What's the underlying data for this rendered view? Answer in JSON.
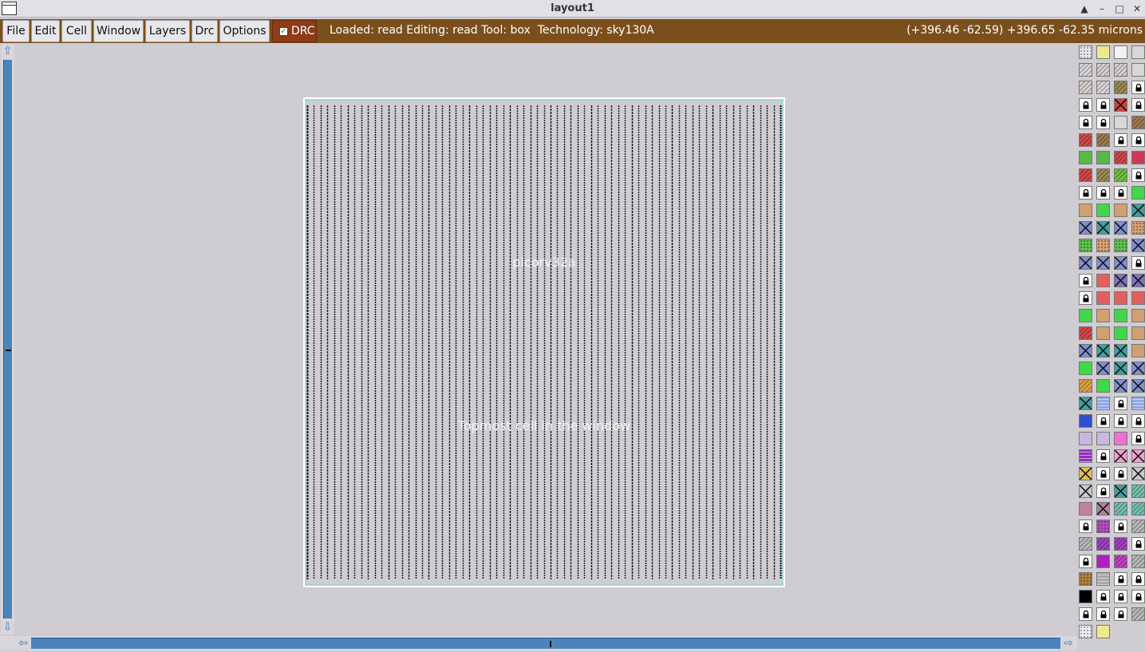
{
  "window": {
    "title": "layout1",
    "buttons": [
      "up-arrow-icon",
      "minimize-icon",
      "maximize-icon",
      "close-icon"
    ]
  },
  "menubar": {
    "items": [
      "File",
      "Edit",
      "Cell",
      "Window",
      "Layers",
      "Drc",
      "Options"
    ],
    "drc_toggle": {
      "label": "DRC",
      "checked": true
    }
  },
  "status": {
    "text": "Loaded: read Editing: read Tool: box  Technology: sky130A",
    "coords": "(+396.46 -62.59) +396.65 -62.35 microns"
  },
  "layout": {
    "cell_name": "picorv32a",
    "caption": "Topmost cell in the window"
  },
  "colors": {
    "menubar_bg": "#7a4f1c",
    "drc_bg": "#8f3a18",
    "scrollbar": "#4a84bb",
    "canvas_bg": "#cfcdd2",
    "cell_outline": "#ffffff",
    "cell_dots": "#5ed8d8"
  },
  "palette": {
    "columns": 4,
    "swatches": [
      "grid",
      "yellow",
      "outline",
      "plain",
      "diag-dark",
      "diag-light",
      "diag-light",
      "plain",
      "diag-light",
      "diag-dark",
      "olive",
      "lock-red",
      "lock",
      "lock",
      "red-x",
      "lock-red",
      "lock",
      "lock",
      "plain",
      "brown",
      "red",
      "brown",
      "lock",
      "lock",
      "green",
      "green",
      "red",
      "crimson",
      "red",
      "olive",
      "green-diag",
      "lock",
      "lock",
      "lock",
      "lock",
      "bright-green",
      "tan",
      "bright-green",
      "tan",
      "teal-x",
      "blue-x",
      "teal-x",
      "blue-x",
      "tan-dots",
      "green-dots",
      "tan-dots",
      "green-dots",
      "blue-x",
      "blue-x",
      "blue-x",
      "blue-x",
      "lock",
      "lock",
      "salmon",
      "purple-x",
      "purple-x",
      "lock",
      "salmon",
      "salmon",
      "salmon",
      "bright-green",
      "tan",
      "bright-green",
      "tan",
      "red",
      "tan",
      "bright-green",
      "tan",
      "blue-x",
      "teal-x",
      "teal-x",
      "tan",
      "bright-green",
      "blue-x",
      "teal-x",
      "blue-x",
      "orange-diag",
      "bright-green",
      "blue-x",
      "blue-x",
      "teal-x",
      "wave-blue",
      "lock",
      "wave-blue",
      "blue-check",
      "lock",
      "lock",
      "lock",
      "lavender",
      "lavender",
      "pink",
      "lock",
      "purple-wave",
      "lock",
      "pink-x",
      "pink-x",
      "yellow-x",
      "lock",
      "lock",
      "gray-x",
      "gray-x",
      "lock",
      "teal-x",
      "teal-diag",
      "mauve",
      "mauve-x",
      "teal-diag",
      "teal-diag",
      "lock",
      "purple-dots",
      "lock",
      "gray-diag",
      "gray-diag",
      "purple-diag",
      "purple-diag",
      "lock",
      "lock",
      "magenta",
      "magenta-diag",
      "gray-diag",
      "brown-dots",
      "gray-wave",
      "lock",
      "lock",
      "black",
      "lock",
      "lock",
      "lock",
      "lock",
      "lock",
      "lock",
      "gray-diag",
      "white-dots",
      "yellow"
    ]
  }
}
